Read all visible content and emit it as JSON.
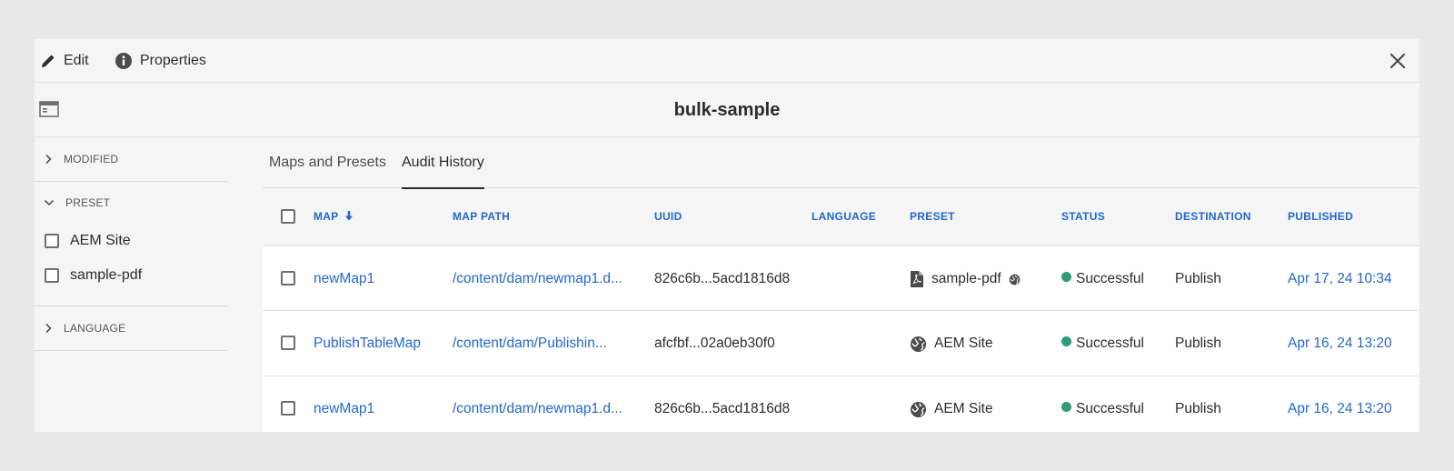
{
  "toolbar": {
    "edit_label": "Edit",
    "properties_label": "Properties"
  },
  "page_title": "bulk-sample",
  "sidebar": {
    "sections": [
      {
        "label": "MODIFIED",
        "expanded": false,
        "options": []
      },
      {
        "label": "PRESET",
        "expanded": true,
        "options": [
          "AEM Site",
          "sample-pdf"
        ]
      },
      {
        "label": "LANGUAGE",
        "expanded": false,
        "options": []
      }
    ]
  },
  "tabs": [
    {
      "label": "Maps and Presets",
      "active": false
    },
    {
      "label": "Audit History",
      "active": true
    }
  ],
  "table": {
    "columns": [
      "MAP",
      "MAP PATH",
      "UUID",
      "LANGUAGE",
      "PRESET",
      "STATUS",
      "DESTINATION",
      "PUBLISHED"
    ],
    "sort_column": "MAP",
    "sort_direction": "descending",
    "rows": [
      {
        "map": "newMap1",
        "map_path": "/content/dam/newmap1.d...",
        "uuid": "826c6b...5acd1816d8",
        "language": "",
        "preset": "sample-pdf",
        "preset_icon": "pdf-icon",
        "preset_extra_icon": "globe-icon",
        "status": "Successful",
        "destination": "Publish",
        "published": "Apr 17, 24 10:34"
      },
      {
        "map": "PublishTableMap",
        "map_path": "/content/dam/Publishin...",
        "uuid": "afcfbf...02a0eb30f0",
        "language": "",
        "preset": "AEM Site",
        "preset_icon": "globe-icon",
        "status": "Successful",
        "destination": "Publish",
        "published": "Apr 16, 24 13:20"
      },
      {
        "map": "newMap1",
        "map_path": "/content/dam/newmap1.d...",
        "uuid": "826c6b...5acd1816d8",
        "language": "",
        "preset": "AEM Site",
        "preset_icon": "globe-icon",
        "status": "Successful",
        "destination": "Publish",
        "published": "Apr 16, 24 13:20"
      }
    ]
  },
  "colors": {
    "link": "#1f67d2",
    "status_success": "#2d9d78",
    "text": "#2c2c2c",
    "panel_bg": "#f5f5f5"
  }
}
